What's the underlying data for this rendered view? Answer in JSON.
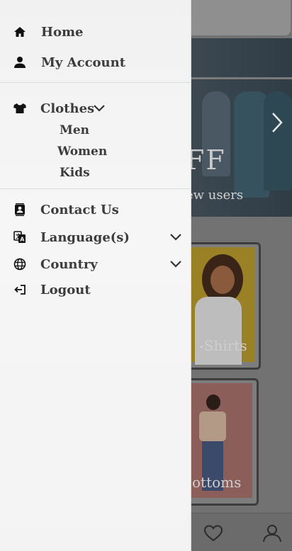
{
  "drawer": {
    "top_items": [
      {
        "label": "Home",
        "icon": "home-icon"
      },
      {
        "label": "My Account",
        "icon": "person-icon"
      }
    ],
    "clothes": {
      "label": "Clothes",
      "icon": "tshirt-icon",
      "expanded": true,
      "subitems": [
        "Men",
        "Women",
        "Kids"
      ]
    },
    "bottom_items": [
      {
        "label": "Contact Us",
        "icon": "contact-book-icon"
      },
      {
        "label": "Language(s)",
        "icon": "translate-icon"
      },
      {
        "label": "Country",
        "icon": "globe-icon"
      },
      {
        "label": "Logout",
        "icon": "logout-icon"
      }
    ]
  },
  "background": {
    "hero": {
      "title": "FF",
      "subtitle": "ew users"
    },
    "cards": [
      {
        "label": "-Shirts"
      },
      {
        "label": "ottoms"
      }
    ],
    "bottom_nav": [
      "heart-icon",
      "profile-icon"
    ]
  },
  "colors": {
    "drawer_bg": "#f3f3f3",
    "overlay": "#727272",
    "text": "#3c3c3c",
    "icon": "#111111"
  }
}
